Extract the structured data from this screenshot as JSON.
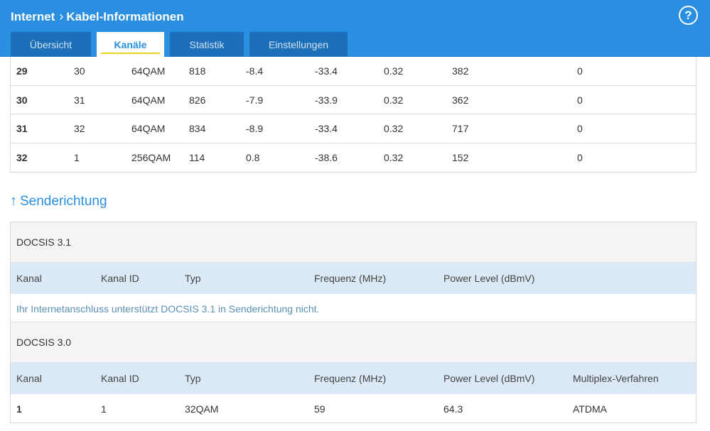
{
  "header": {
    "breadcrumb": [
      "Internet",
      "Kabel-Informationen"
    ],
    "help_label": "?"
  },
  "tabs": [
    {
      "label": "Übersicht",
      "active": false
    },
    {
      "label": "Kanäle",
      "active": true
    },
    {
      "label": "Statistik",
      "active": false
    },
    {
      "label": "Einstellungen",
      "active": false
    }
  ],
  "downstream_rows": [
    [
      "29",
      "30",
      "64QAM",
      "818",
      "-8.4",
      "-33.4",
      "0.32",
      "382",
      "0"
    ],
    [
      "30",
      "31",
      "64QAM",
      "826",
      "-7.9",
      "-33.9",
      "0.32",
      "362",
      "0"
    ],
    [
      "31",
      "32",
      "64QAM",
      "834",
      "-8.9",
      "-33.4",
      "0.32",
      "717",
      "0"
    ],
    [
      "32",
      "1",
      "256QAM",
      "114",
      "0.8",
      "-38.6",
      "0.32",
      "152",
      "0"
    ]
  ],
  "upstream": {
    "title": "Senderichtung",
    "docsis31": {
      "label": "DOCSIS 3.1",
      "headers": [
        "Kanal",
        "Kanal ID",
        "Typ",
        "Frequenz (MHz)",
        "Power Level (dBmV)"
      ],
      "note": "Ihr Internetanschluss unterstützt DOCSIS 3.1 in Senderichtung nicht."
    },
    "docsis30": {
      "label": "DOCSIS 3.0",
      "headers": [
        "Kanal",
        "Kanal ID",
        "Typ",
        "Frequenz (MHz)",
        "Power Level (dBmV)",
        "Multiplex-Verfahren"
      ],
      "rows": [
        [
          "1",
          "1",
          "32QAM",
          "59",
          "64.3",
          "ATDMA"
        ]
      ]
    }
  },
  "colors": {
    "header": "#2a8fe0",
    "tab_inactive": "#1c6fb8",
    "tab_underline": "#f3d21c",
    "column_header_bg": "#dbe8f5"
  }
}
